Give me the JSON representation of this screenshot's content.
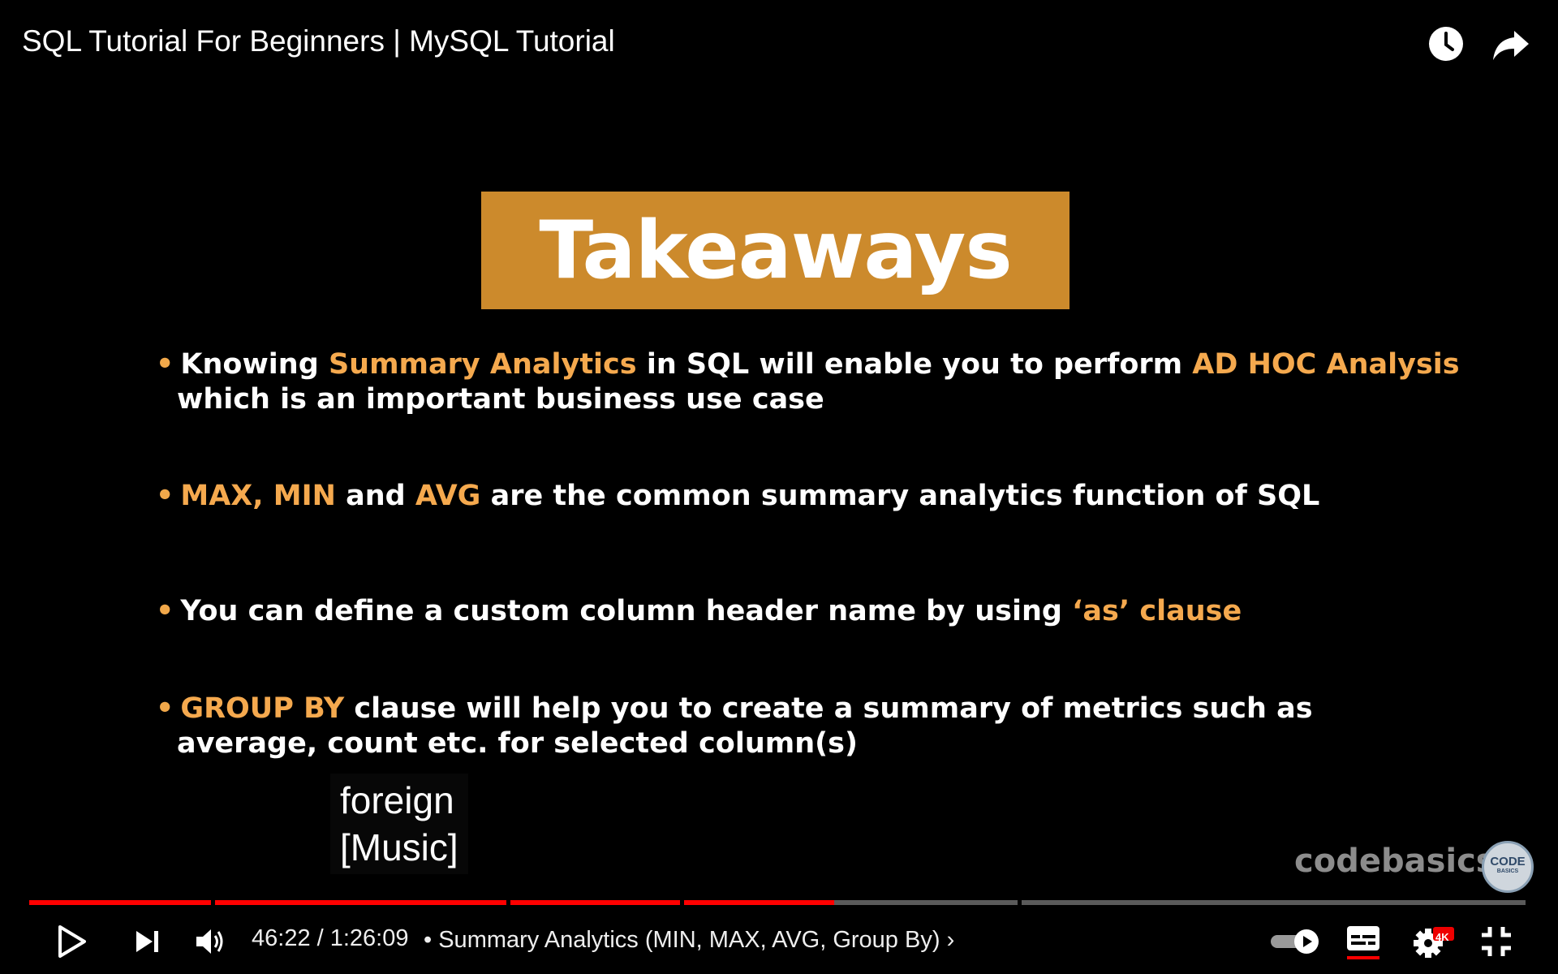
{
  "window": {
    "title": "SQL Tutorial For Beginners | MySQL Tutorial"
  },
  "slide": {
    "heading": "Takeaways",
    "bullets": [
      {
        "line1_a": "Knowing ",
        "line1_hl1": "Summary Analytics",
        "line1_b": "  in SQL will enable you to perform ",
        "line1_hl2": "AD HOC Analysis",
        "line2": "which is an important business use case"
      },
      {
        "hl1": "MAX, MIN",
        "a": " and ",
        "hl2": "AVG",
        "b": " are the common summary analytics function of SQL"
      },
      {
        "a": "You can define a custom column header name by using ",
        "hl": "‘as’ clause"
      },
      {
        "hl": "GROUP BY",
        "a": " clause will help you to create a summary of metrics such as",
        "line2": "average, count etc. for selected column(s)"
      }
    ]
  },
  "captions": {
    "line1": "foreign",
    "line2": "[Music]"
  },
  "watermark": {
    "text": "codebasics.",
    "logo_top": "CODE",
    "logo_bottom": "BASICS"
  },
  "player": {
    "current_time": "46:22",
    "duration": "1:26:09",
    "time_display": "46:22 / 1:26:09",
    "chapter_separator": "•",
    "chapter": "Summary Analytics (MIN, MAX, AVG, Group By)",
    "chapter_arrow": "›",
    "progress_fraction": 0.5378,
    "quality_badge": "4K",
    "autoplay_on": true,
    "captions_on": true,
    "accent_color": "#ff0000"
  },
  "chapters_fractions": [
    {
      "start": 0.0,
      "end": 0.1237
    },
    {
      "start": 0.1237,
      "end": 0.3207
    },
    {
      "start": 0.3207,
      "end": 0.4364
    },
    {
      "start": 0.4364,
      "end": 0.6616
    },
    {
      "start": 0.6616,
      "end": 1.0
    }
  ],
  "colors": {
    "badge": "#cc8a2c",
    "highlight": "#f5a94e",
    "background": "#000000"
  }
}
